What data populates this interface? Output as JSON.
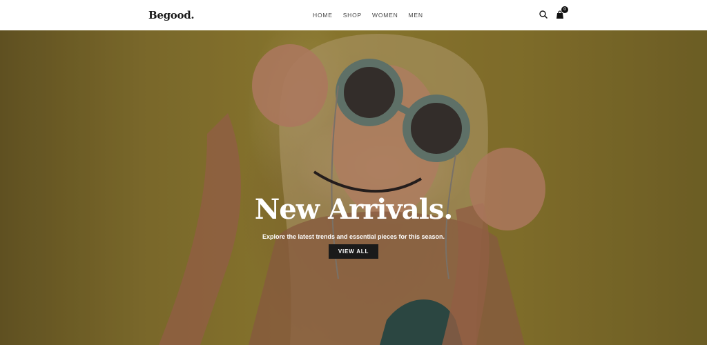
{
  "brand": {
    "logo": "Begood."
  },
  "nav": {
    "items": [
      {
        "label": "HOME"
      },
      {
        "label": "SHOP"
      },
      {
        "label": "WOMEN"
      },
      {
        "label": "MEN"
      }
    ]
  },
  "header_icons": {
    "search_icon": "search-icon",
    "cart_icon": "shopping-bag-icon",
    "cart_count": "0"
  },
  "hero": {
    "title": "New Arrivals.",
    "subtitle": "Explore the latest trends and essential pieces for this season.",
    "button_label": "VIEW ALL",
    "colors": {
      "wall": "#8f7a2f",
      "overlay": "#000000",
      "button": "#1a1a1a",
      "text": "#ffffff"
    }
  }
}
